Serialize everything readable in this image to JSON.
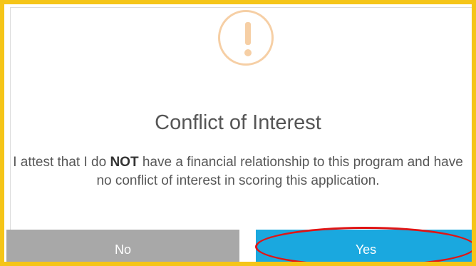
{
  "dialog": {
    "title": "Conflict of Interest",
    "message_part1": "I attest that I do ",
    "message_emphasis": "NOT",
    "message_part2": " have a financial relationship to this program and have no conflict of interest in scoring this application.",
    "icon": "exclamation-warning-icon",
    "buttons": {
      "no_label": "No",
      "yes_label": "Yes"
    }
  },
  "colors": {
    "frame_border": "#f5c518",
    "warning_icon": "#f6cfa5",
    "no_button": "#a8a8a8",
    "yes_button": "#1aa8df",
    "highlight_annotation": "#e01515"
  }
}
